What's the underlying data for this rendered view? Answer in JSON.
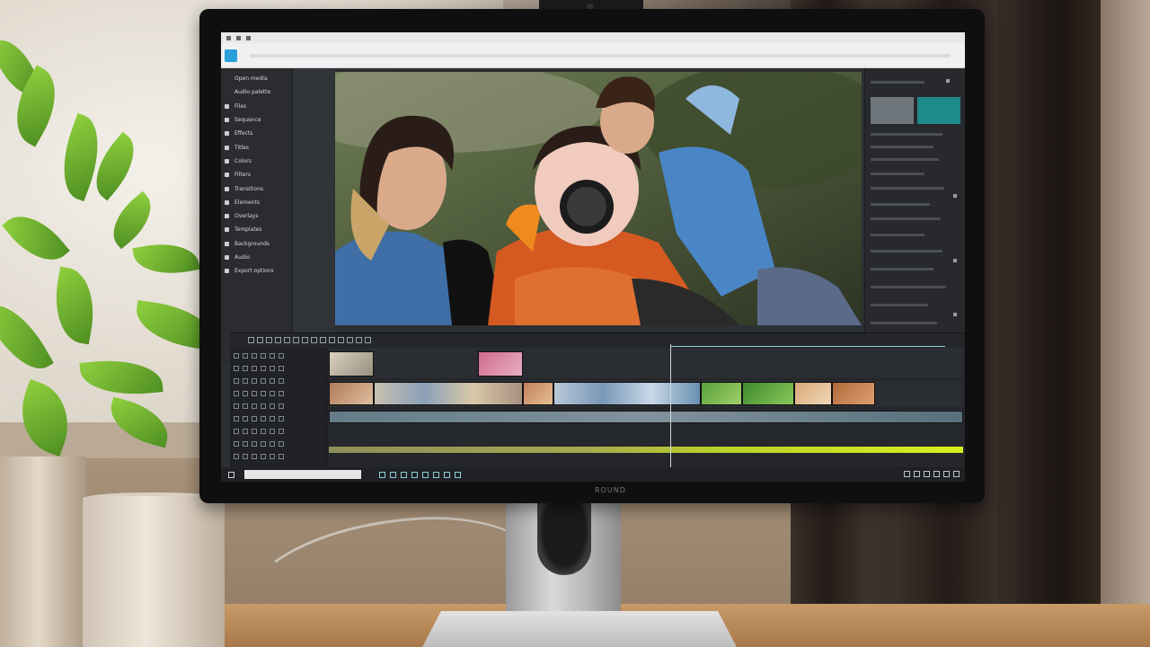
{
  "app": {
    "monitor_brand": "ROUND"
  },
  "left_panel": {
    "items": [
      {
        "label": "Open media",
        "icon": "folder-icon",
        "plain": true
      },
      {
        "label": "Audio palette",
        "icon": "audio-icon",
        "plain": true
      },
      {
        "label": "Files",
        "icon": "file-icon"
      },
      {
        "label": "Sequence",
        "icon": "sequence-icon"
      },
      {
        "label": "Effects",
        "icon": "effects-icon"
      },
      {
        "label": "Titles",
        "icon": "titles-icon"
      },
      {
        "label": "Colors",
        "icon": "color-icon"
      },
      {
        "label": "Filters",
        "icon": "filter-icon"
      },
      {
        "label": "Transitions",
        "icon": "transition-icon"
      },
      {
        "label": "Elements",
        "icon": "elements-icon"
      },
      {
        "label": "Overlays",
        "icon": "overlay-icon"
      },
      {
        "label": "Templates",
        "icon": "template-icon"
      },
      {
        "label": "Backgrounds",
        "icon": "background-icon"
      },
      {
        "label": "Audio",
        "icon": "music-icon"
      },
      {
        "label": "Export options",
        "icon": "export-icon"
      }
    ]
  },
  "colors": {
    "accent": "#2aa0d8",
    "teal_tile": "#1f8a8a",
    "audio_waveform": "#c6e62a",
    "panel": "#2a2c30"
  }
}
